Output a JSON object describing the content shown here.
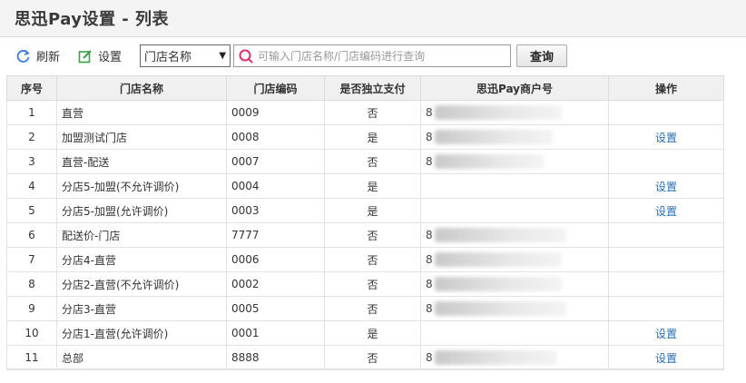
{
  "title": "思迅Pay设置 - 列表",
  "toolbar": {
    "refresh_label": "刷新",
    "setting_label": "设置",
    "select_value": "门店名称",
    "search_placeholder": "可输入门店名称/门店编码进行查询",
    "query_label": "查询"
  },
  "table": {
    "headers": [
      "序号",
      "门店名称",
      "门店编码",
      "是否独立支付",
      "思迅Pay商户号",
      "操作"
    ],
    "rows": [
      {
        "seq": "1",
        "name": "直营",
        "code": "0009",
        "independent": "否",
        "merchant": "8",
        "op": ""
      },
      {
        "seq": "2",
        "name": "加盟测试门店",
        "code": "0008",
        "independent": "是",
        "merchant": "8",
        "op": "设置"
      },
      {
        "seq": "3",
        "name": "直营-配送",
        "code": "0007",
        "independent": "否",
        "merchant": "8",
        "op": ""
      },
      {
        "seq": "4",
        "name": "分店5-加盟(不允许调价)",
        "code": "0004",
        "independent": "是",
        "merchant": "",
        "op": "设置"
      },
      {
        "seq": "5",
        "name": "分店5-加盟(允许调价)",
        "code": "0003",
        "independent": "是",
        "merchant": "",
        "op": "设置"
      },
      {
        "seq": "6",
        "name": "配送价-门店",
        "code": "7777",
        "independent": "否",
        "merchant": "8",
        "op": ""
      },
      {
        "seq": "7",
        "name": "分店4-直营",
        "code": "0006",
        "independent": "否",
        "merchant": "8",
        "op": ""
      },
      {
        "seq": "8",
        "name": "分店2-直营(不允许调价)",
        "code": "0002",
        "independent": "否",
        "merchant": "8",
        "op": ""
      },
      {
        "seq": "9",
        "name": "分店3-直营",
        "code": "0005",
        "independent": "否",
        "merchant": "8",
        "op": ""
      },
      {
        "seq": "10",
        "name": "分店1-直营(允许调价)",
        "code": "0001",
        "independent": "是",
        "merchant": "",
        "op": "设置"
      },
      {
        "seq": "11",
        "name": "总部",
        "code": "8888",
        "independent": "否",
        "merchant": "8",
        "op": "设置"
      }
    ]
  },
  "colors": {
    "refresh_icon": "#3a7bd5",
    "setting_icon": "#3aa048",
    "search_icon": "#d6336c",
    "link": "#2a6db0"
  }
}
